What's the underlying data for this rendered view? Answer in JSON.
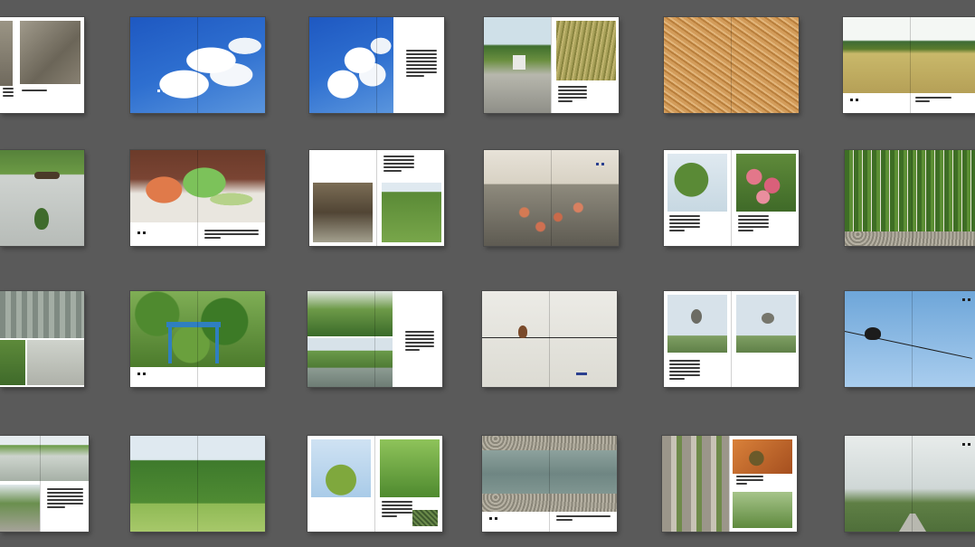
{
  "view": {
    "name": "page-thumbnails",
    "background": "#5a5a5a",
    "rows": [
      {
        "row": 1,
        "spreads": [
          "grass-stone-partial",
          "blue-sky-clouds",
          "clouds-with-text",
          "roadside-rice-field",
          "rice-grain-closeup",
          "village-field-panorama"
        ]
      },
      {
        "row": 2,
        "spreads": [
          "leaf-on-pavement",
          "vegetables-in-bag",
          "irrigation-and-plants",
          "persimmons-on-road",
          "tree-and-flowers",
          "vine-wall"
        ]
      },
      {
        "row": 3,
        "spreads": [
          "building-and-canal",
          "irrigation-gate",
          "canal-with-text",
          "bird-on-wire",
          "shrike-pair",
          "drongo-on-wire"
        ]
      },
      {
        "row": 4,
        "spreads": [
          "canal-path",
          "tree-lined-path",
          "tree-branches",
          "river-gravel",
          "tree-trunks-and-insects",
          "misty-field-road"
        ]
      }
    ]
  }
}
